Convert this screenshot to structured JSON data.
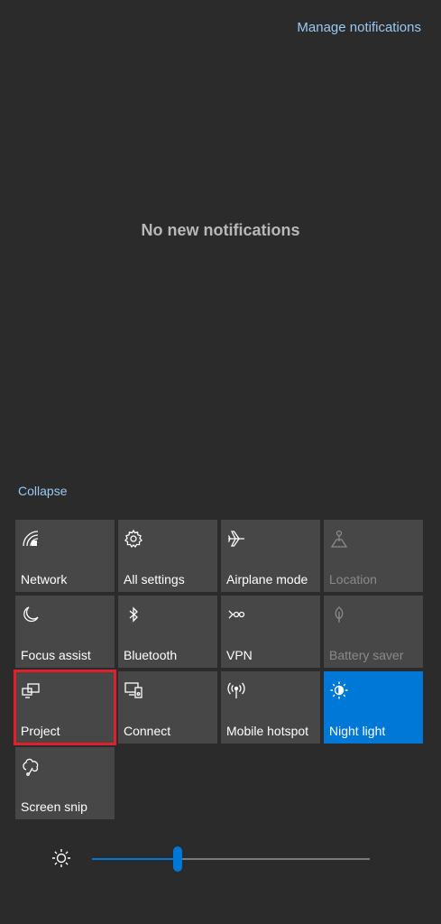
{
  "header": {
    "manage_notifications": "Manage notifications"
  },
  "notifications": {
    "empty_message": "No new notifications"
  },
  "quick_actions": {
    "collapse_label": "Collapse",
    "tiles": [
      {
        "label": "Network",
        "icon": "network-icon",
        "state": "normal"
      },
      {
        "label": "All settings",
        "icon": "gear-icon",
        "state": "normal"
      },
      {
        "label": "Airplane mode",
        "icon": "airplane-icon",
        "state": "normal"
      },
      {
        "label": "Location",
        "icon": "location-icon",
        "state": "disabled"
      },
      {
        "label": "Focus assist",
        "icon": "moon-icon",
        "state": "normal"
      },
      {
        "label": "Bluetooth",
        "icon": "bluetooth-icon",
        "state": "normal"
      },
      {
        "label": "VPN",
        "icon": "vpn-icon",
        "state": "normal"
      },
      {
        "label": "Battery saver",
        "icon": "battery-saver-icon",
        "state": "disabled"
      },
      {
        "label": "Project",
        "icon": "project-icon",
        "state": "highlighted"
      },
      {
        "label": "Connect",
        "icon": "connect-icon",
        "state": "normal"
      },
      {
        "label": "Mobile hotspot",
        "icon": "hotspot-icon",
        "state": "normal"
      },
      {
        "label": "Night light",
        "icon": "night-light-icon",
        "state": "active"
      },
      {
        "label": "Screen snip",
        "icon": "screen-snip-icon",
        "state": "normal"
      }
    ]
  },
  "brightness": {
    "icon": "brightness-icon",
    "level": 0.31
  },
  "colors": {
    "accent": "#0078d7",
    "link": "#99c9f3",
    "tile_bg": "#474747",
    "background": "#2b2b2b",
    "highlight_border": "#e0202a"
  }
}
